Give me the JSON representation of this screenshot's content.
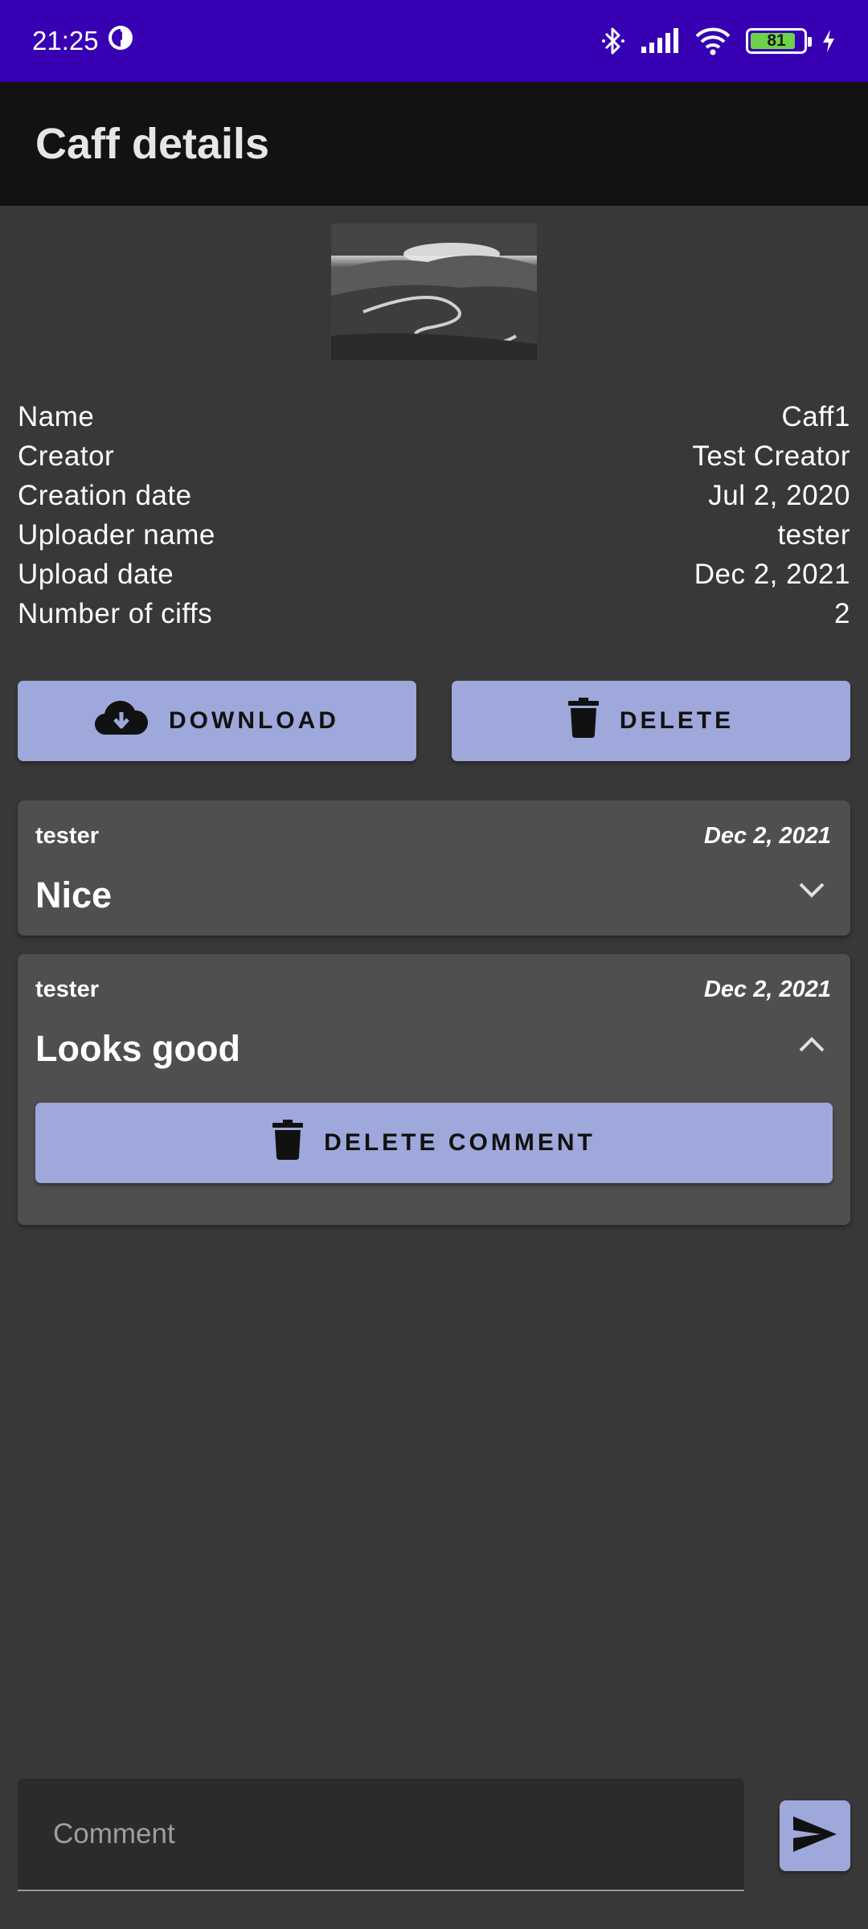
{
  "status_bar": {
    "time": "21:25",
    "battery_level": "81",
    "icons": [
      "bluetooth-icon",
      "signal-icon",
      "wifi-icon",
      "battery-icon",
      "charging-icon"
    ]
  },
  "app_bar": {
    "title": "Caff details"
  },
  "details": [
    {
      "label": "Name",
      "value": "Caff1"
    },
    {
      "label": "Creator",
      "value": "Test Creator"
    },
    {
      "label": "Creation date",
      "value": "Jul 2, 2020"
    },
    {
      "label": "Uploader name",
      "value": "tester"
    },
    {
      "label": "Upload date",
      "value": "Dec 2, 2021"
    },
    {
      "label": "Number of ciffs",
      "value": "2"
    }
  ],
  "actions": {
    "download_label": "DOWNLOAD",
    "delete_label": "DELETE"
  },
  "comments": [
    {
      "author": "tester",
      "date": "Dec 2, 2021",
      "text": "Nice",
      "expanded": false
    },
    {
      "author": "tester",
      "date": "Dec 2, 2021",
      "text": "Looks good",
      "expanded": true,
      "delete_label": "DELETE COMMENT"
    }
  ],
  "comment_input": {
    "placeholder": "Comment",
    "value": ""
  },
  "colors": {
    "status_bar": "#3700b3",
    "app_bar": "#121212",
    "background": "#383838",
    "button": "#9fa8da",
    "card": "#4f4f4f"
  }
}
